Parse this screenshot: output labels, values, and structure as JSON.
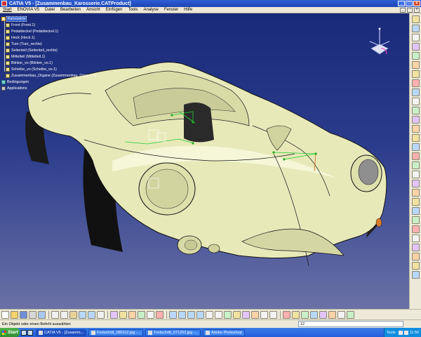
{
  "window": {
    "title": "CATIA V5 - [Zusammenbau_Karosserie.CATProduct]",
    "min": "_",
    "max": "□",
    "close": "×"
  },
  "menu": {
    "items": [
      "Start",
      "ENOVIA V5",
      "Datei",
      "Bearbeiten",
      "Ansicht",
      "Einfügen",
      "Tools",
      "Analyse",
      "Fenster",
      "Hilfe"
    ],
    "doc_min": "_",
    "doc_restore": "▫",
    "doc_close": "×"
  },
  "tree": {
    "root": "Karosserie",
    "children": [
      "Front (Front.1)",
      "Pedaldeckel (Pedaldeckel.1)",
      "Heck (Heck.1)",
      "Tuer (Tuer_rechts)",
      "Seitenteil (Seitenteil_rechts)",
      "Mittelteil (Mittelteil.1)",
      "Blinker_vo (Blinker_vo.1)",
      "Scheibe_vo (Scheibe_vo.1)",
      "Zusammenbau_Organe (Zusammenbau_Organe.1)"
    ],
    "constraints": "Bedingungen",
    "applications": "Applications"
  },
  "status": {
    "message": "Ein Objekt oder einen Befehl auswählen",
    "command_value": "12"
  },
  "taskbar": {
    "start": "Start",
    "tasks": [
      "CATIA V5 - [Zusamm...",
      "Fortschritt_080112.jpg -...",
      "Fortschritt_071203.jpg -...",
      "Adobe Photoshop"
    ],
    "tools_label": "Tools",
    "clock": "11:50"
  },
  "colors": {
    "body": "#e7e9b9",
    "viewport_top": "#1a2a7a",
    "viewport_bottom": "#6a71a6",
    "sketch": "#22cc33"
  }
}
